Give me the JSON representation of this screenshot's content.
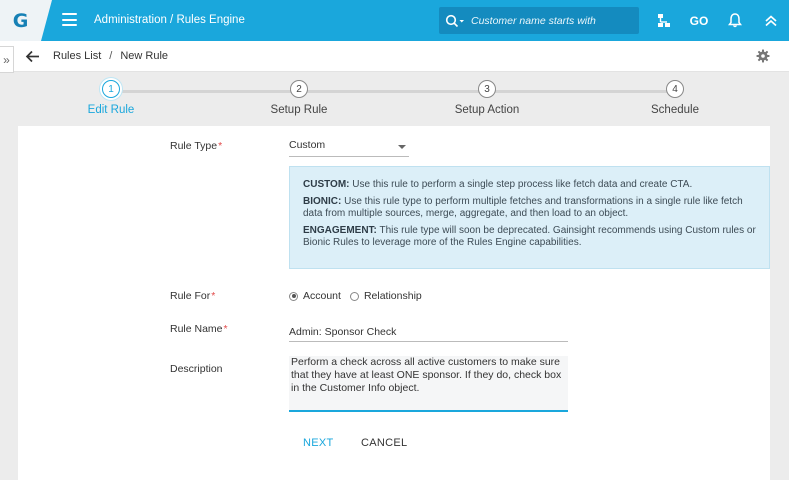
{
  "app": {
    "logo_letter": "G",
    "title": "Administration / Rules Engine"
  },
  "search": {
    "placeholder": "Customer name starts with"
  },
  "top_icons": {
    "go_label": "GO"
  },
  "breadcrumb": {
    "expander": "»",
    "items": [
      "Rules List",
      "New Rule"
    ],
    "separator": "/"
  },
  "stepper": {
    "steps": [
      {
        "number": "1",
        "label": "Edit Rule",
        "active": true
      },
      {
        "number": "2",
        "label": "Setup Rule",
        "active": false
      },
      {
        "number": "3",
        "label": "Setup Action",
        "active": false
      },
      {
        "number": "4",
        "label": "Schedule",
        "active": false
      }
    ]
  },
  "form": {
    "rule_type": {
      "label": "Rule Type",
      "required_mark": "*",
      "value": "Custom"
    },
    "info": {
      "custom_title": "CUSTOM:",
      "custom_text": " Use this rule to perform a single step process like fetch data and create CTA.",
      "bionic_title": "BIONIC:",
      "bionic_text": " Use this rule type to perform multiple fetches and transformations in a single rule like fetch data from multiple sources, merge, aggregate, and then load to an object.",
      "engagement_title": "ENGAGEMENT:",
      "engagement_text": " This rule type will soon be deprecated. Gainsight recommends using Custom rules or Bionic Rules to leverage more of the Rules Engine capabilities."
    },
    "rule_for": {
      "label": "Rule For",
      "required_mark": "*",
      "options": [
        "Account",
        "Relationship"
      ],
      "selected": "Account"
    },
    "rule_name": {
      "label": "Rule Name",
      "required_mark": "*",
      "value": "Admin: Sponsor Check"
    },
    "description": {
      "label": "Description",
      "value": "Perform a check across all active customers to make sure that they have at least ONE sponsor. If they do, check box in the Customer Info object."
    },
    "buttons": {
      "next": "NEXT",
      "cancel": "CANCEL"
    }
  },
  "colors": {
    "accent": "#1aa7dc",
    "info_bg": "#dceff8",
    "required": "#e24a4a"
  }
}
